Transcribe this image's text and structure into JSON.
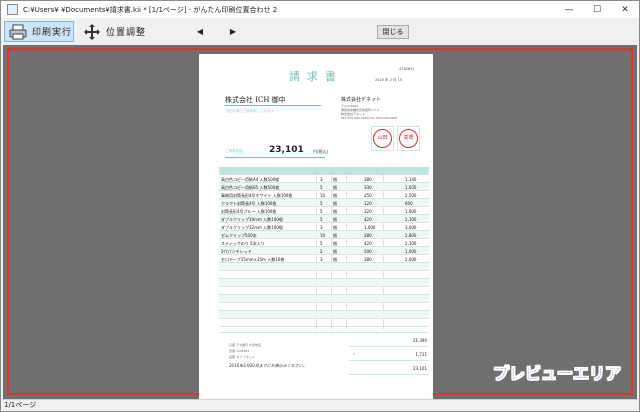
{
  "window": {
    "title": "C:¥Users¥      ¥Documents¥請求書.kii * [1/1ページ] - がんたん印刷位置合わせ 2",
    "minimize": "—",
    "maximize": "☐",
    "close": "✕"
  },
  "toolbar": {
    "print_label": "印刷実行",
    "adjust_label": "位置調整",
    "prev": "◀",
    "next": "▶",
    "close_label": "閉じる"
  },
  "preview": {
    "label": "プレビューエリア"
  },
  "invoice": {
    "title": "請求書",
    "number": "4780631",
    "date": "2016  年   2   月   15",
    "customer": "株式会社 ICH  御中",
    "customer_note": "下記の通りご請求申し上げます。",
    "issuer": "株式会社デネット",
    "issuer_info": [
      "〒370-8601",
      "群馬県前橋市高前長町1-2-3",
      "株式会社デネット",
      "TEL 000-000-0000  FAX 000-000-0000"
    ],
    "stamp1": "山田",
    "stamp2": "高橋",
    "total_label": "ご請求金額",
    "total_value": "23,101",
    "total_unit": "円(税込)",
    "items": [
      {
        "name": "高白色コピー用紙A4 入数500枚",
        "qty": "3",
        "unit": "個",
        "price": "380",
        "amount": "1,140"
      },
      {
        "name": "高白色コピー用紙B5 入数500枚",
        "qty": "5",
        "unit": "個",
        "price": "330",
        "amount": "1,650"
      },
      {
        "name": "事務用封筒長形4号ホワイト 入数100枚",
        "qty": "10",
        "unit": "個",
        "price": "250",
        "amount": "2,500"
      },
      {
        "name": "クラフト封筒長4号 入数100枚",
        "qty": "5",
        "unit": "個",
        "price": "120",
        "amount": "600"
      },
      {
        "name": "封筒長形4号ブルー 入数100枚",
        "qty": "5",
        "unit": "個",
        "price": "320",
        "amount": "1,600"
      },
      {
        "name": "ダブルクリップ19mm 入数100個",
        "qty": "5",
        "unit": "個",
        "price": "420",
        "amount": "2,100"
      },
      {
        "name": "ダブルクリップ32mm 入数100個",
        "qty": "3",
        "unit": "個",
        "price": "1,000",
        "amount": "3,000"
      },
      {
        "name": "ゼムクリップ500本",
        "qty": "10",
        "unit": "個",
        "price": "280",
        "amount": "2,800"
      },
      {
        "name": "スティックのり 5本入り",
        "qty": "5",
        "unit": "個",
        "price": "420",
        "amount": "2,100"
      },
      {
        "name": "2穴パンチレッド",
        "qty": "2",
        "unit": "個",
        "price": "500",
        "amount": "1,000"
      },
      {
        "name": "セロテープ15mm×35m 入数10巻",
        "qty": "3",
        "unit": "個",
        "price": "380",
        "amount": "2,000"
      }
    ],
    "subtotal": "21,390",
    "tax_rate": "8",
    "tax": "1,711",
    "grand_total": "23,101",
    "bank_lines": [
      "口座 デネ銀行  大沢支店",
      "普通  1234567",
      "名義 カブ デネット"
    ],
    "bank_note": "2016年3月20日までにお振込みください。"
  },
  "status": {
    "page": "1/1ページ"
  }
}
